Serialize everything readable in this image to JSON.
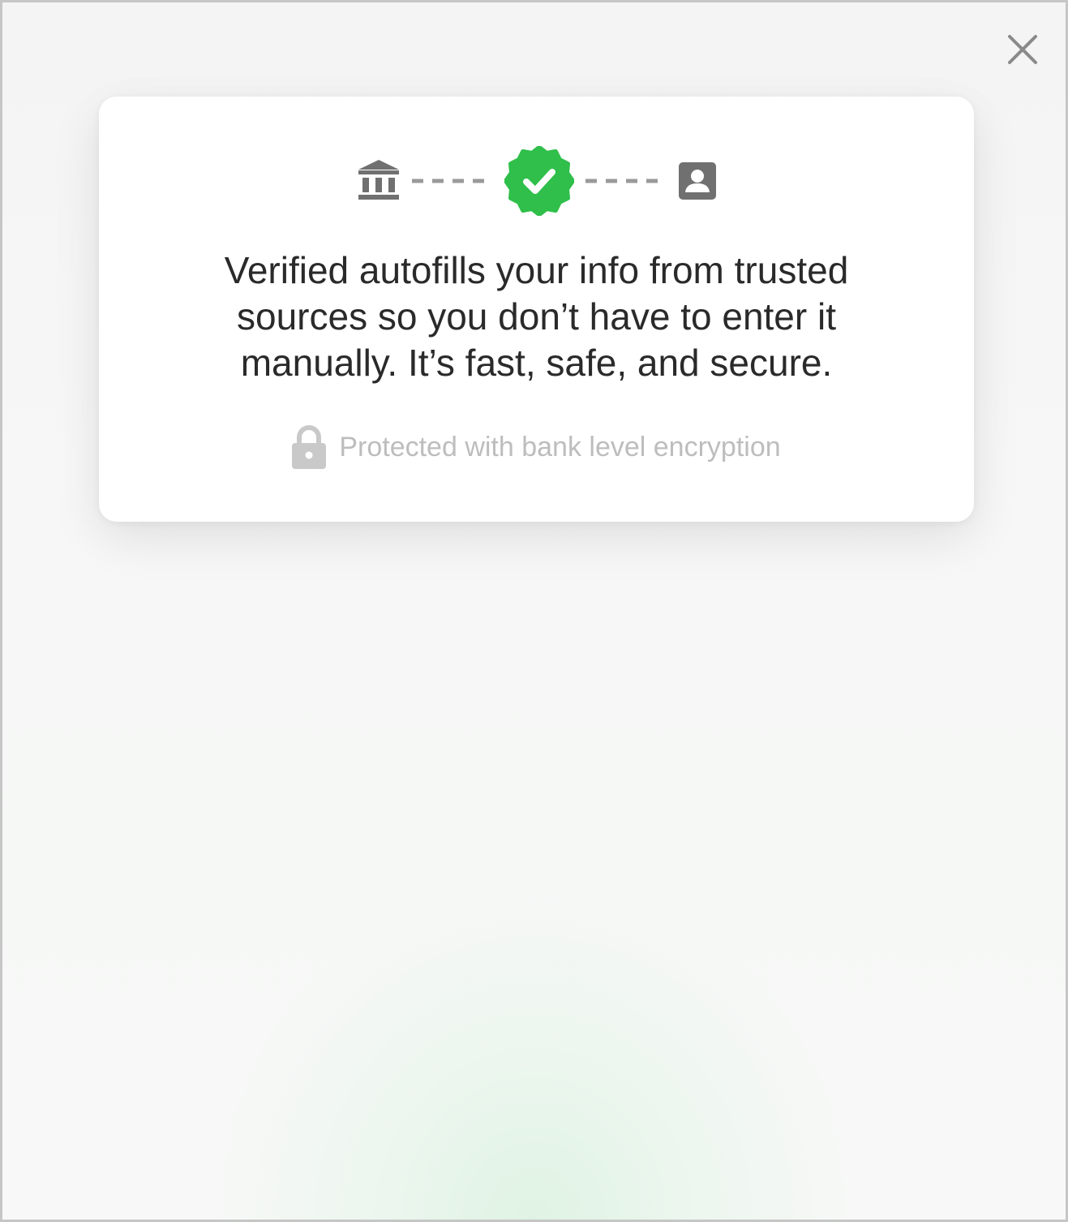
{
  "dialog": {
    "close_icon": "close-icon",
    "flow_icons": [
      "bank-icon",
      "verified-badge-icon",
      "user-card-icon"
    ],
    "message_lines": [
      "Verified autofills your info from trusted",
      "sources so you don’t have to enter it",
      "manually. It’s fast, safe, and secure."
    ],
    "security_icon": "lock-icon",
    "security_text": "Protected with bank level encryption"
  },
  "colors": {
    "accent_green": "#2fbf4a",
    "icon_gray": "#707070",
    "text_dark": "#2a2a2a",
    "text_muted": "#bdbdbd"
  }
}
